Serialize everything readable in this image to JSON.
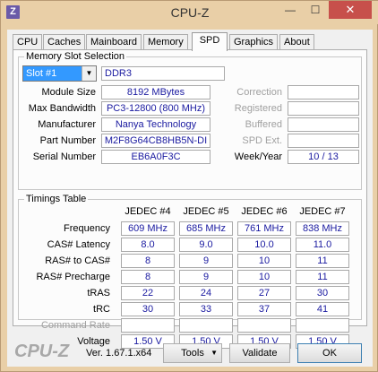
{
  "window": {
    "title": "CPU-Z",
    "app_icon_letter": "Z",
    "minimize_glyph": "—",
    "maximize_glyph": "☐",
    "close_glyph": "✕"
  },
  "tabs": [
    {
      "label": "CPU"
    },
    {
      "label": "Caches"
    },
    {
      "label": "Mainboard"
    },
    {
      "label": "Memory"
    },
    {
      "label": "SPD",
      "active": true
    },
    {
      "label": "Graphics"
    },
    {
      "label": "About"
    }
  ],
  "slot_group": {
    "title": "Memory Slot Selection",
    "slot_select": "Slot #1",
    "memory_type": "DDR3",
    "module_size_label": "Module Size",
    "module_size": "8192 MBytes",
    "max_bandwidth_label": "Max Bandwidth",
    "max_bandwidth": "PC3-12800 (800 MHz)",
    "manufacturer_label": "Manufacturer",
    "manufacturer": "Nanya Technology",
    "part_number_label": "Part Number",
    "part_number": "M2F8G64CB8HB5N-DI",
    "serial_number_label": "Serial Number",
    "serial_number": "EB6A0F3C",
    "correction_label": "Correction",
    "correction": "",
    "registered_label": "Registered",
    "registered": "",
    "buffered_label": "Buffered",
    "buffered": "",
    "spd_ext_label": "SPD Ext.",
    "spd_ext": "",
    "week_year_label": "Week/Year",
    "week_year": "10 / 13"
  },
  "timings": {
    "title": "Timings Table",
    "columns": [
      "JEDEC #4",
      "JEDEC #5",
      "JEDEC #6",
      "JEDEC #7"
    ],
    "rows": [
      {
        "label": "Frequency",
        "values": [
          "609 MHz",
          "685 MHz",
          "761 MHz",
          "838 MHz"
        ]
      },
      {
        "label": "CAS# Latency",
        "values": [
          "8.0",
          "9.0",
          "10.0",
          "11.0"
        ]
      },
      {
        "label": "RAS# to CAS#",
        "values": [
          "8",
          "9",
          "10",
          "11"
        ]
      },
      {
        "label": "RAS# Precharge",
        "values": [
          "8",
          "9",
          "10",
          "11"
        ]
      },
      {
        "label": "tRAS",
        "values": [
          "22",
          "24",
          "27",
          "30"
        ]
      },
      {
        "label": "tRC",
        "values": [
          "30",
          "33",
          "37",
          "41"
        ]
      },
      {
        "label": "Command Rate",
        "values": [
          "",
          "",
          "",
          ""
        ],
        "dim": true
      },
      {
        "label": "Voltage",
        "values": [
          "1.50 V",
          "1.50 V",
          "1.50 V",
          "1.50 V"
        ]
      }
    ]
  },
  "footer": {
    "logo": "CPU-Z",
    "version": "Ver. 1.67.1.x64",
    "tools_label": "Tools",
    "validate_label": "Validate",
    "ok_label": "OK"
  },
  "colors": {
    "window_frame": "#e9cfa7",
    "close_button": "#c7504b",
    "value_text": "#1a1aa0",
    "selection": "#3399ff"
  }
}
